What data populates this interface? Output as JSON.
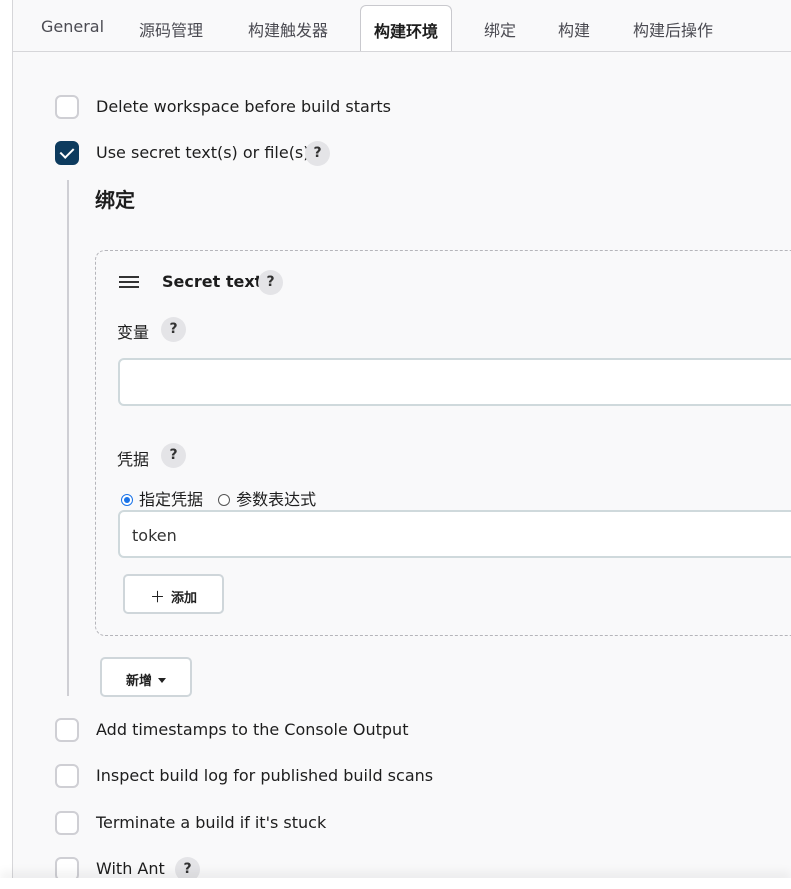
{
  "tabs": [
    {
      "label": "General"
    },
    {
      "label": "源码管理"
    },
    {
      "label": "构建触发器"
    },
    {
      "label": "构建环境"
    },
    {
      "label": "绑定"
    },
    {
      "label": "构建"
    },
    {
      "label": "构建后操作"
    }
  ],
  "options": {
    "delete_workspace": {
      "label": "Delete workspace before build starts",
      "checked": false
    },
    "use_secret": {
      "label": "Use secret text(s) or file(s)",
      "checked": true
    },
    "timestamps": {
      "label": "Add timestamps to the Console Output",
      "checked": false
    },
    "inspect_log": {
      "label": "Inspect build log for published build scans",
      "checked": false
    },
    "terminate_stuck": {
      "label": "Terminate a build if it's stuck",
      "checked": false
    },
    "with_ant": {
      "label": "With Ant",
      "checked": false
    }
  },
  "bindings": {
    "title": "绑定",
    "secret_text": {
      "title": "Secret text",
      "variable_label": "变量",
      "variable_value": "",
      "credentials_label": "凭据",
      "radio_specific": "指定凭据",
      "radio_param": "参数表达式",
      "credentials_value": "token",
      "add_button": "添加"
    },
    "new_button": "新增"
  },
  "help_glyph": "?",
  "plus_glyph": "＋"
}
